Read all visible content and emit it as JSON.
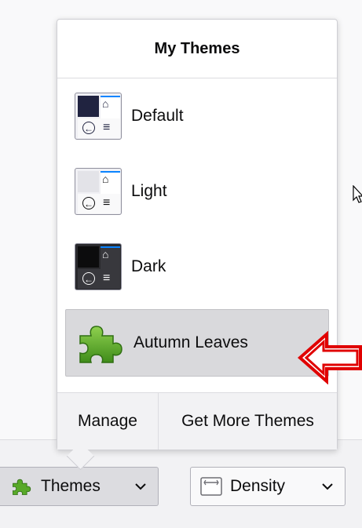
{
  "panel": {
    "title": "My Themes",
    "themes": [
      {
        "label": "Default",
        "icon": "default-theme-icon"
      },
      {
        "label": "Light",
        "icon": "light-theme-icon"
      },
      {
        "label": "Dark",
        "icon": "dark-theme-icon"
      },
      {
        "label": "Autumn Leaves",
        "icon": "puzzle-piece-icon",
        "selected": true
      }
    ],
    "footer": {
      "manage_label": "Manage",
      "get_more_label": "Get More Themes"
    }
  },
  "toolbar": {
    "themes_label": "Themes",
    "density_label": "Density"
  },
  "colors": {
    "accent": "#0a84ff",
    "puzzle_green": "#58a928",
    "highlight_red": "#e00000"
  }
}
